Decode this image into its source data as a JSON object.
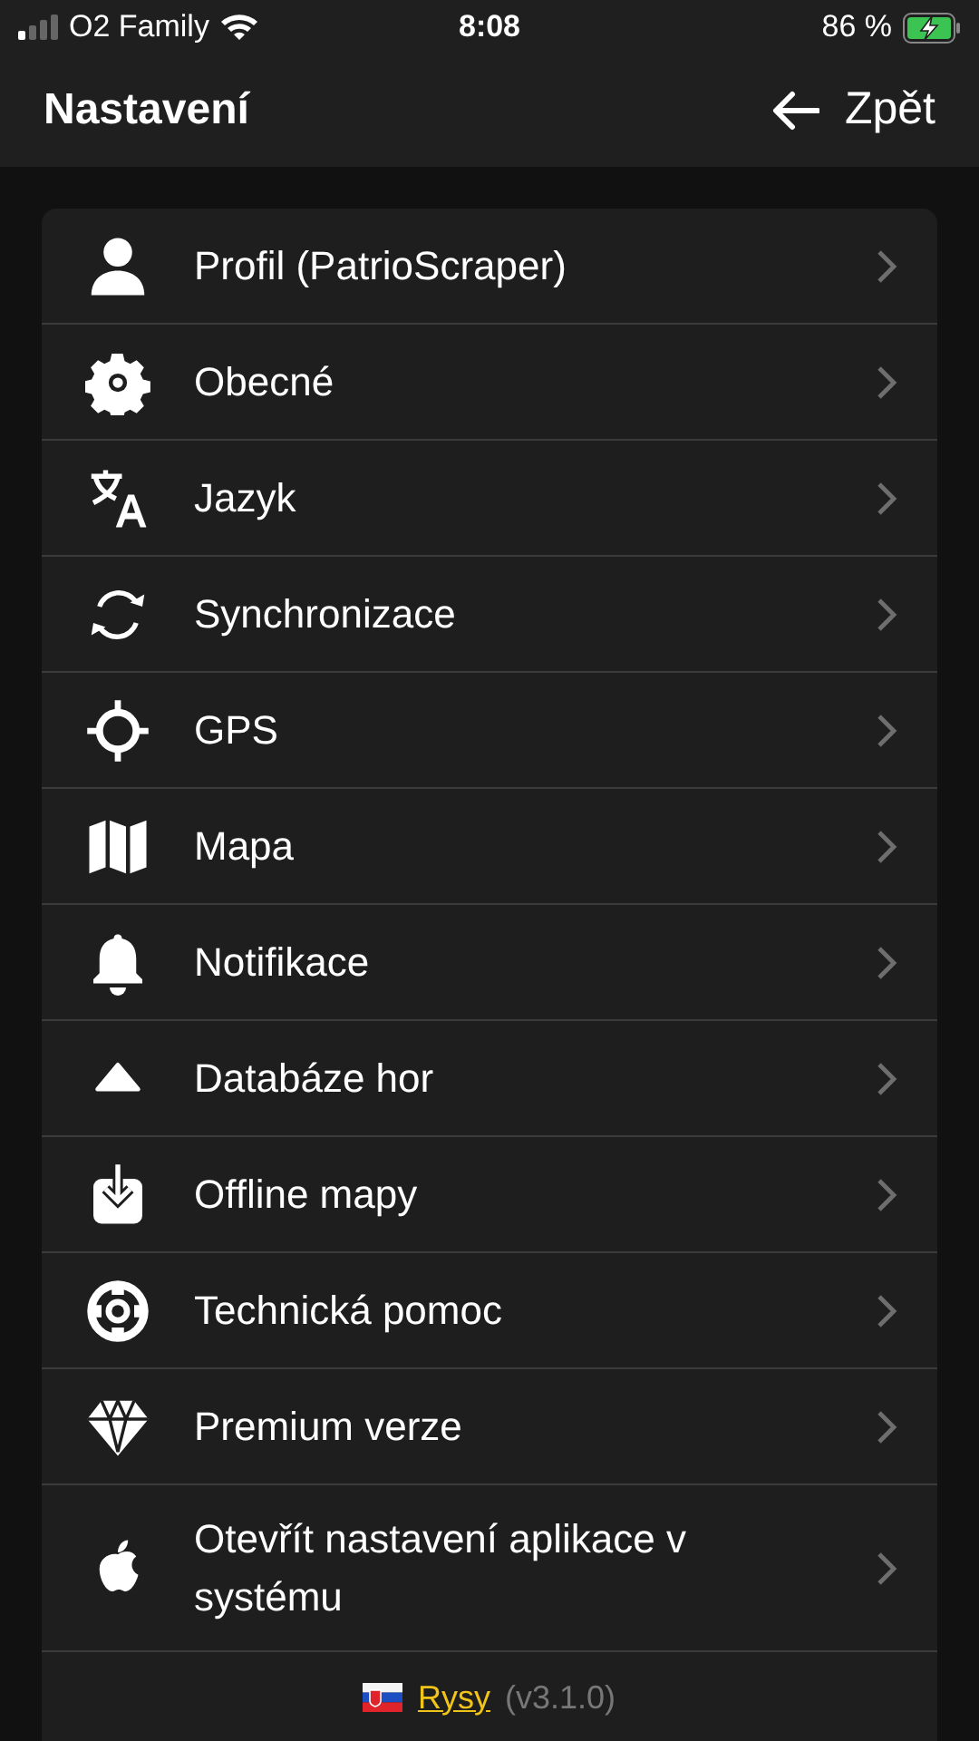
{
  "status_bar": {
    "carrier": "O2 Family",
    "time": "8:08",
    "battery": "86 %"
  },
  "header": {
    "title": "Nastavení",
    "back": "Zpět"
  },
  "menu": [
    {
      "label": "Profil (PatrioScraper)"
    },
    {
      "label": "Obecné"
    },
    {
      "label": "Jazyk"
    },
    {
      "label": "Synchronizace"
    },
    {
      "label": "GPS"
    },
    {
      "label": "Mapa"
    },
    {
      "label": "Notifikace"
    },
    {
      "label": "Databáze hor"
    },
    {
      "label": "Offline mapy"
    },
    {
      "label": "Technická pomoc"
    },
    {
      "label": "Premium verze"
    },
    {
      "label": "Otevřít nastavení aplikace v systému"
    }
  ],
  "footer": {
    "app_link": "Rysy",
    "version": "(v3.1.0)"
  }
}
